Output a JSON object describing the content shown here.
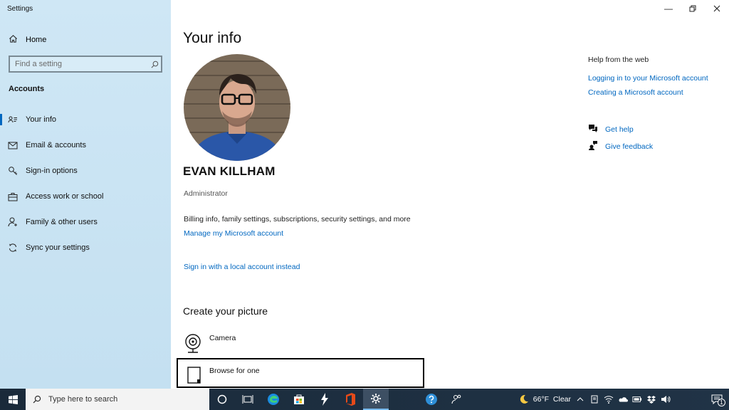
{
  "window": {
    "title": "Settings",
    "controls": [
      "minimize",
      "restore",
      "close"
    ]
  },
  "sidebar": {
    "home_label": "Home",
    "search_placeholder": "Find a setting",
    "section_label": "Accounts",
    "items": [
      {
        "label": "Your info",
        "icon": "contact-card-icon",
        "active": true
      },
      {
        "label": "Email & accounts",
        "icon": "mail-icon"
      },
      {
        "label": "Sign-in options",
        "icon": "key-icon"
      },
      {
        "label": "Access work or school",
        "icon": "briefcase-icon"
      },
      {
        "label": "Family & other users",
        "icon": "person-add-icon"
      },
      {
        "label": "Sync your settings",
        "icon": "sync-icon"
      }
    ]
  },
  "main": {
    "title": "Your info",
    "user_name": "EVAN KILLHAM",
    "user_role": "Administrator",
    "billing_text": "Billing info, family settings, subscriptions, security settings, and more",
    "manage_link": "Manage my Microsoft account",
    "local_link": "Sign in with a local account instead",
    "create_title": "Create your picture",
    "camera_label": "Camera",
    "browse_label": "Browse for one"
  },
  "help": {
    "title": "Help from the web",
    "links": [
      "Logging in to your Microsoft account",
      "Creating a Microsoft account"
    ],
    "get_help": "Get help",
    "give_feedback": "Give feedback"
  },
  "taskbar": {
    "search_placeholder": "Type here to search",
    "apps": [
      "cortana-icon",
      "task-view-icon",
      "edge-icon",
      "store-icon",
      "app-icon",
      "office-icon",
      "settings-icon"
    ],
    "weather": "66°F  Clear",
    "notification_count": "1"
  },
  "colors": {
    "accent": "#0067c0",
    "sidebar": "#c9e4f3",
    "taskbar": "#1d2d3f"
  }
}
